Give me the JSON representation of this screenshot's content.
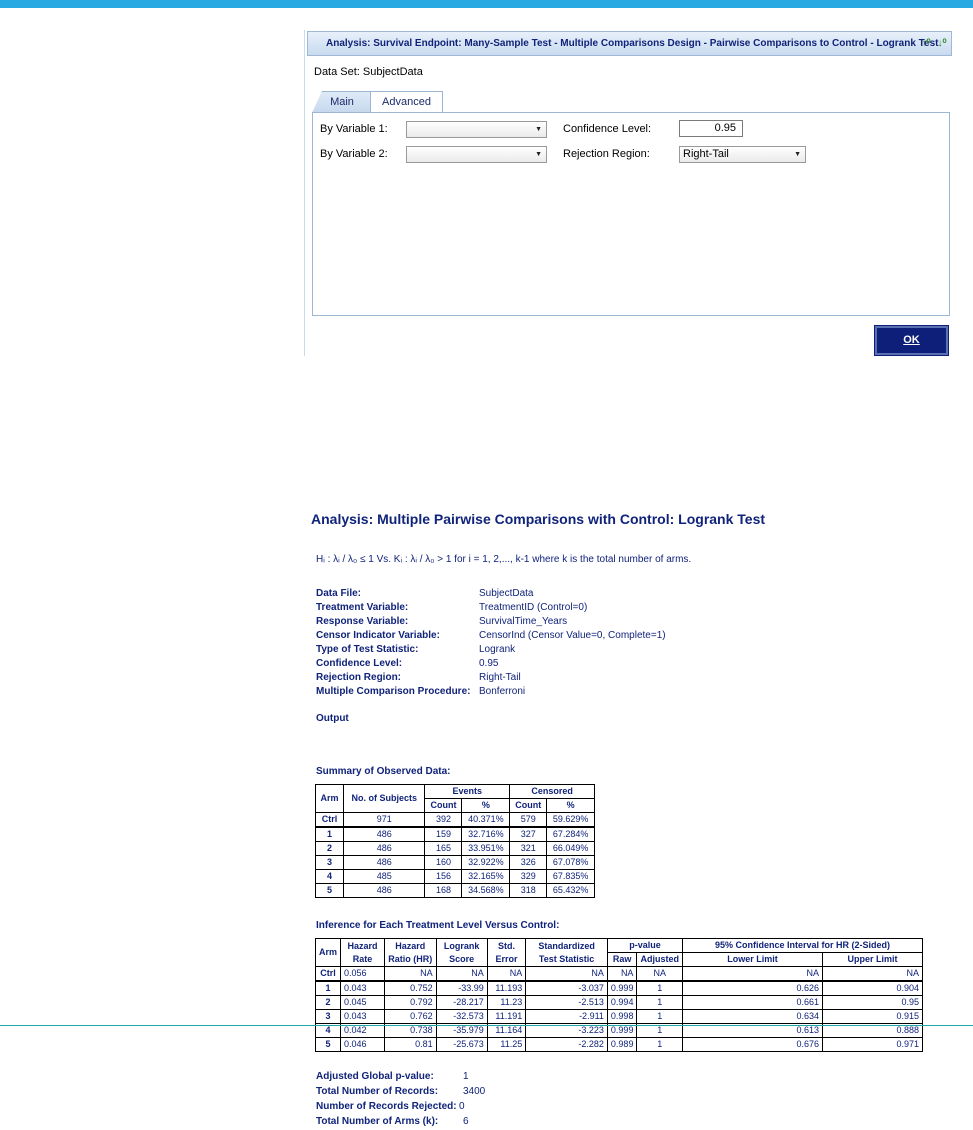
{
  "dialog": {
    "title": "Analysis: Survival Endpoint: Many-Sample Test - Multiple Comparisons Design - Pairwise Comparisons to Control - Logrank Test",
    "dataset_label": "Data Set: SubjectData",
    "tabs": [
      {
        "label": "Main"
      },
      {
        "label": "Advanced"
      }
    ],
    "by_var1_label": "By Variable 1:",
    "by_var2_label": "By Variable 2:",
    "by_var1_value": "",
    "by_var2_value": "",
    "conf_level_label": "Confidence Level:",
    "conf_level_value": "0.95",
    "rejection_label": "Rejection Region:",
    "rejection_value": "Right-Tail",
    "ok_label": "OK",
    "icons": [
      "sort-ascending-icon",
      "sort-descending-icon"
    ]
  },
  "output": {
    "title": "Analysis: Multiple Pairwise Comparisons with Control: Logrank Test",
    "hypothesis": "Hᵢ : λᵢ / λ₀ ≤ 1 Vs. Kᵢ : λᵢ / λ₀ > 1 for i = 1, 2,..., k-1 where k is the total number of arms.",
    "info": [
      {
        "key": "Data File:",
        "value": "SubjectData"
      },
      {
        "key": "Treatment Variable:",
        "value": "TreatmentID (Control=0)"
      },
      {
        "key": "Response Variable:",
        "value": "SurvivalTime_Years"
      },
      {
        "key": "Censor Indicator Variable:",
        "value": "CensorInd (Censor Value=0, Complete=1)"
      },
      {
        "key": "Type of Test Statistic:",
        "value": "Logrank"
      },
      {
        "key": "Confidence Level:",
        "value": "0.95"
      },
      {
        "key": "Rejection Region:",
        "value": "Right-Tail"
      },
      {
        "key": "Multiple Comparison Procedure:",
        "value": "Bonferroni"
      }
    ],
    "output_label": "Output",
    "observed_title": "Summary of Observed Data:",
    "observed_headers": {
      "arm": "Arm",
      "subjects": "No. of Subjects",
      "events": "Events",
      "censored": "Censored",
      "count": "Count",
      "pct": "%"
    },
    "observed_rows": [
      {
        "arm": "Ctrl",
        "n": "971",
        "ec": "392",
        "ep": "40.371%",
        "cc": "579",
        "cp": "59.629%"
      },
      {
        "arm": "1",
        "n": "486",
        "ec": "159",
        "ep": "32.716%",
        "cc": "327",
        "cp": "67.284%"
      },
      {
        "arm": "2",
        "n": "486",
        "ec": "165",
        "ep": "33.951%",
        "cc": "321",
        "cp": "66.049%"
      },
      {
        "arm": "3",
        "n": "486",
        "ec": "160",
        "ep": "32.922%",
        "cc": "326",
        "cp": "67.078%"
      },
      {
        "arm": "4",
        "n": "485",
        "ec": "156",
        "ep": "32.165%",
        "cc": "329",
        "cp": "67.835%"
      },
      {
        "arm": "5",
        "n": "486",
        "ec": "168",
        "ep": "34.568%",
        "cc": "318",
        "cp": "65.432%"
      }
    ],
    "inference_title": "Inference for Each Treatment Level Versus Control:",
    "inference_headers": {
      "arm": "Arm",
      "hazard_rate": "Hazard Rate",
      "hazard_ratio": "Hazard Ratio (HR)",
      "logrank": "Logrank Score",
      "stderr": "Std. Error",
      "stat": "Standardized Test Statistic",
      "pvalue": "p-value",
      "raw": "Raw",
      "adjusted": "Adjusted",
      "ci": "95% Confidence Interval for HR (2-Sided)",
      "lower": "Lower Limit",
      "upper": "Upper Limit"
    },
    "inference_rows": [
      {
        "arm": "Ctrl",
        "hr": "0.056",
        "ratio": "NA",
        "score": "NA",
        "se": "NA",
        "stat": "NA",
        "raw": "NA",
        "adj": "NA",
        "lo": "NA",
        "up": "NA"
      },
      {
        "arm": "1",
        "hr": "0.043",
        "ratio": "0.752",
        "score": "-33.99",
        "se": "11.193",
        "stat": "-3.037",
        "raw": "0.999",
        "adj": "1",
        "lo": "0.626",
        "up": "0.904"
      },
      {
        "arm": "2",
        "hr": "0.045",
        "ratio": "0.792",
        "score": "-28.217",
        "se": "11.23",
        "stat": "-2.513",
        "raw": "0.994",
        "adj": "1",
        "lo": "0.661",
        "up": "0.95"
      },
      {
        "arm": "3",
        "hr": "0.043",
        "ratio": "0.762",
        "score": "-32.573",
        "se": "11.191",
        "stat": "-2.911",
        "raw": "0.998",
        "adj": "1",
        "lo": "0.634",
        "up": "0.915"
      },
      {
        "arm": "4",
        "hr": "0.042",
        "ratio": "0.738",
        "score": "-35.979",
        "se": "11.164",
        "stat": "-3.223",
        "raw": "0.999",
        "adj": "1",
        "lo": "0.613",
        "up": "0.888"
      },
      {
        "arm": "5",
        "hr": "0.046",
        "ratio": "0.81",
        "score": "-25.673",
        "se": "11.25",
        "stat": "-2.282",
        "raw": "0.989",
        "adj": "1",
        "lo": "0.676",
        "up": "0.971"
      }
    ],
    "summary": [
      {
        "key": "Adjusted Global p-value:",
        "value": "1"
      },
      {
        "key": "Total Number of Records:",
        "value": "3400"
      },
      {
        "key": "Number of Records Rejected:",
        "value": "0"
      },
      {
        "key": "Total Number of Arms (k):",
        "value": "6"
      }
    ]
  },
  "colors": {
    "accent_bar": "#29a9e1",
    "heading": "#10237a",
    "ok_button": "#0e1f79"
  }
}
